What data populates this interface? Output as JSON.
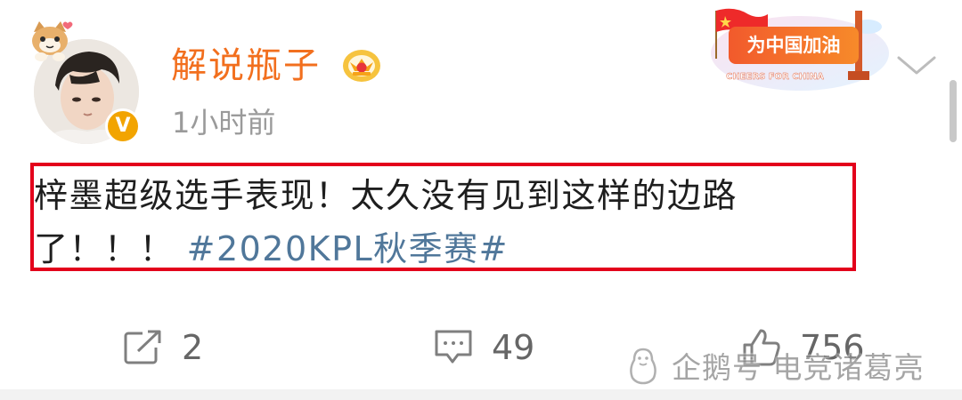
{
  "post": {
    "username": "解说瓶子",
    "timestamp": "1小时前",
    "badge_letter": "V",
    "content": {
      "text": "梓墨超级选手表现！太久没有见到这样的边路了！！！",
      "hashtag": "#2020KPL秋季赛#"
    }
  },
  "banner": {
    "title": "为中国加油",
    "subtitle": "CHEERS FOR CHINA"
  },
  "actions": {
    "share_count": "2",
    "comment_count": "49",
    "like_count": "756"
  },
  "watermark": {
    "text": "企鹅号 电竞诸葛亮"
  },
  "colors": {
    "username": "#f26f1e",
    "hashtag": "#50779a",
    "highlight_border": "#e3001b",
    "verified_badge": "#f2a400"
  },
  "icons": {
    "share": "share-icon",
    "comment": "comment-icon",
    "like": "thumbs-up-icon",
    "menu": "chevron-down-icon",
    "crown": "crown-icon",
    "watermark": "penguin-icon"
  }
}
